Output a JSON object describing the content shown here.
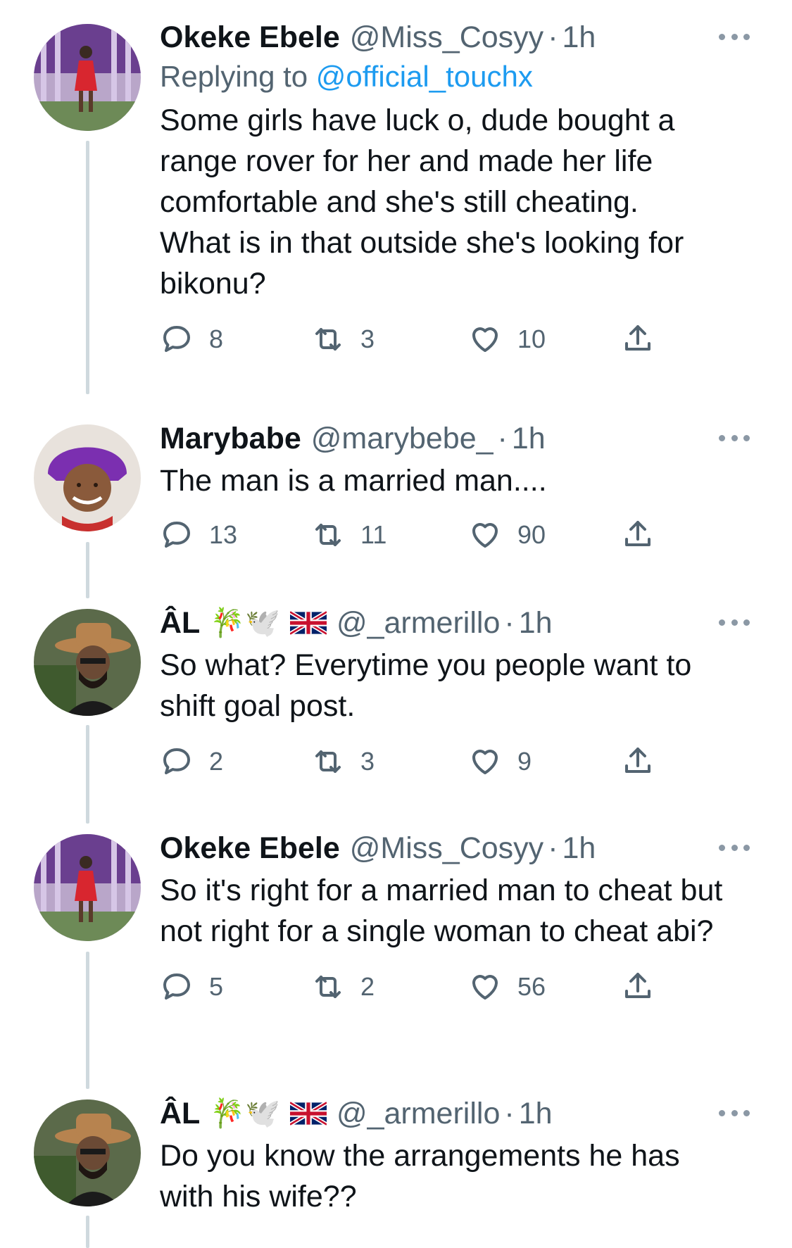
{
  "tweets": [
    {
      "name": "Okeke Ebele",
      "handle": "@Miss_Cosyy",
      "dot": "·",
      "time": "1h",
      "replying_prefix": "Replying to ",
      "replying_to": "@official_touchx",
      "text": "Some girls have luck o, dude bought a range rover for her and made her life comfortable and she's still cheating. What is in that outside she's looking for bikonu?",
      "replies": "8",
      "retweets": "3",
      "likes": "10"
    },
    {
      "name": "Marybabe",
      "handle": "@marybebe_",
      "dot": "·",
      "time": "1h",
      "text": "The man is a married man....",
      "replies": "13",
      "retweets": "11",
      "likes": "90"
    },
    {
      "name": "ÂL",
      "emojis": "🎋🕊️",
      "handle": "@_armerillo",
      "dot": "·",
      "time": "1h",
      "text": "So what? Everytime you people want to shift goal post.",
      "replies": "2",
      "retweets": "3",
      "likes": "9"
    },
    {
      "name": "Okeke Ebele",
      "handle": "@Miss_Cosyy",
      "dot": "·",
      "time": "1h",
      "text": "So it's right for a married man to cheat but not right for a single woman to cheat abi?",
      "replies": "5",
      "retweets": "2",
      "likes": "56"
    },
    {
      "name": "ÂL",
      "emojis": "🎋🕊️",
      "handle": "@_armerillo",
      "dot": "·",
      "time": "1h",
      "text": "Do you know the arrangements he has with his wife??"
    }
  ],
  "icons": {
    "reply": "reply-icon",
    "retweet": "retweet-icon",
    "like": "heart-icon",
    "share": "share-icon",
    "more": "more-icon",
    "flag": "uk-flag-icon"
  },
  "colors": {
    "link": "#1d9bf0",
    "secondary": "#536471",
    "thread_line": "#cfd9de"
  }
}
